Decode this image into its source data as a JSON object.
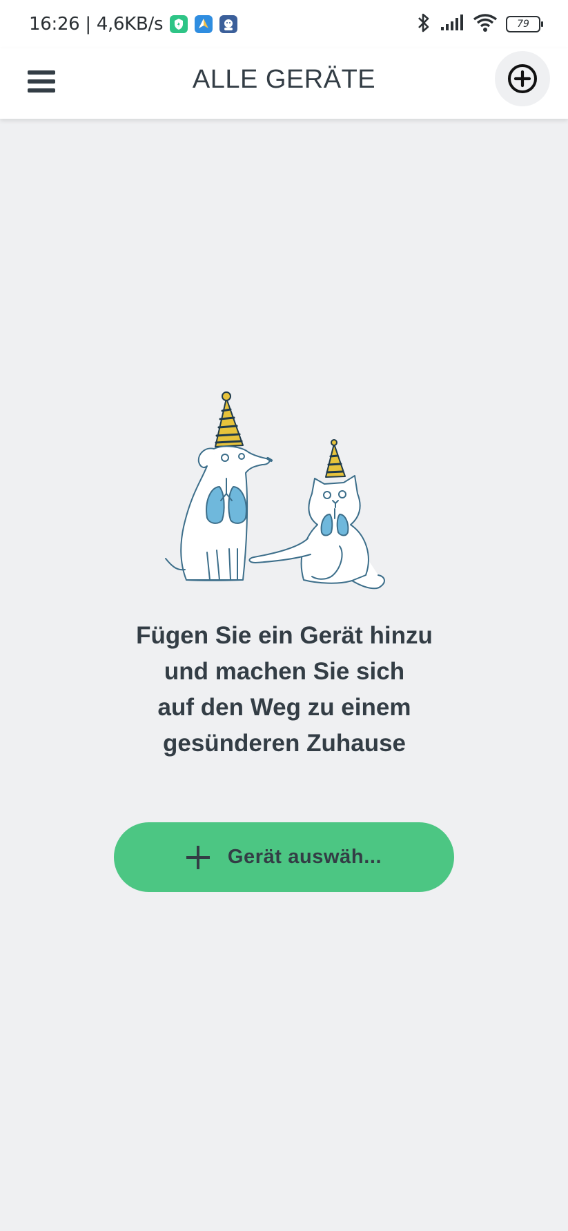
{
  "status_bar": {
    "time_speed": "16:26 | 4,6KB/s",
    "battery": "79",
    "icons": [
      "shield-app-icon",
      "navigation-app-icon",
      "profile-app-icon",
      "bluetooth-icon",
      "signal-icon",
      "wifi-icon",
      "battery-icon"
    ]
  },
  "header": {
    "title": "ALLE GERÄTE",
    "menu_icon": "hamburger-menu-icon",
    "add_icon": "plus-circle-icon"
  },
  "empty_state": {
    "illustration": "dog-and-cat-with-party-hats",
    "message_lines": [
      "Fügen Sie ein Gerät hinzu",
      "und machen Sie sich",
      "auf den Weg zu einem",
      "gesünderen Zuhause"
    ],
    "button_label": "Gerät auswäh..."
  },
  "colors": {
    "background": "#eff0f2",
    "header": "#ffffff",
    "text": "#333d45",
    "accent_green": "#4cc683",
    "lungs_blue": "#6fb8dc",
    "hat_yellow": "#e7c33b"
  }
}
